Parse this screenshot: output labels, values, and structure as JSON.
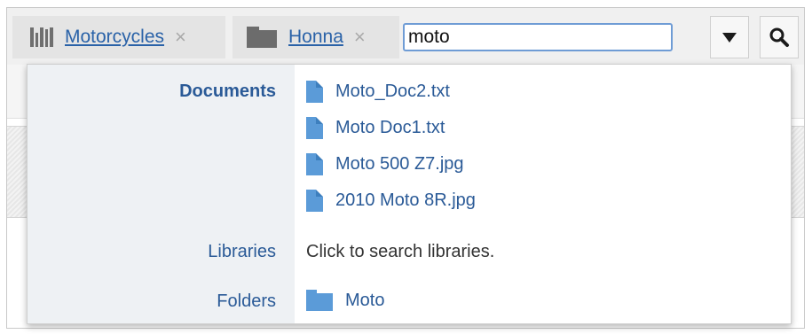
{
  "filters": [
    {
      "icon": "library-icon",
      "label": "Motorcycles",
      "remove": "×"
    },
    {
      "icon": "folder-icon",
      "label": "Honna",
      "remove": "×"
    }
  ],
  "search": {
    "value": "moto"
  },
  "dropdown": {
    "documents": {
      "label": "Documents",
      "items": [
        "Moto_Doc2.txt",
        "Moto Doc1.txt",
        "Moto 500 Z7.jpg",
        "2010 Moto 8R.jpg"
      ]
    },
    "libraries": {
      "label": "Libraries",
      "hint": "Click to search libraries."
    },
    "folders": {
      "label": "Folders",
      "items": [
        "Moto"
      ]
    }
  },
  "colors": {
    "link": "#2a62a8",
    "focus_border": "#6f9cd5",
    "doc_icon": "#5b9bd8"
  }
}
